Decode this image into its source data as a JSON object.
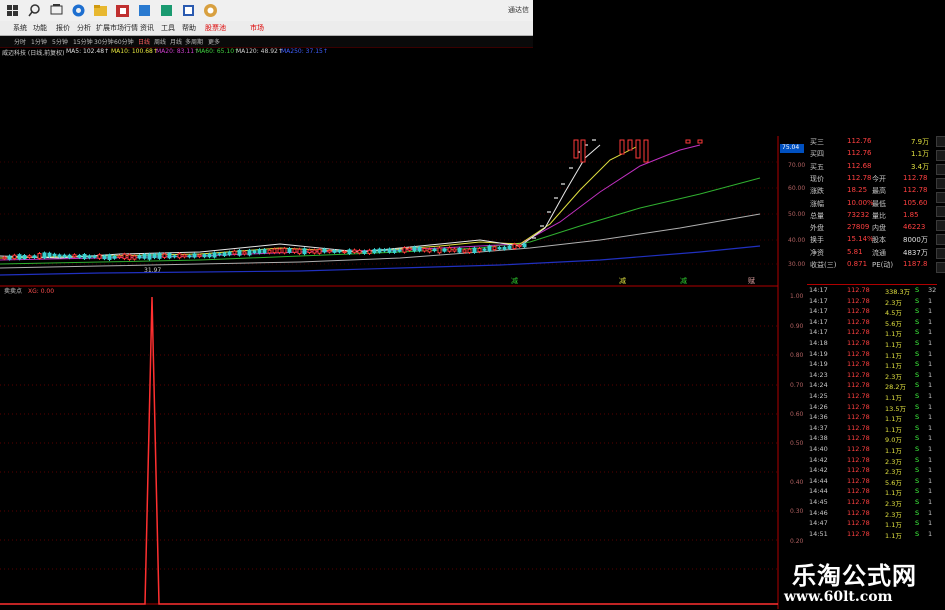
{
  "taskbar": {
    "icons": [
      "windows-icon",
      "search-icon",
      "task-view-icon",
      "edge-icon",
      "explorer-icon",
      "store-icon",
      "app-icon",
      "app-icon-2",
      "mail-icon",
      "trading-app-icon"
    ],
    "right_text": "通达信"
  },
  "menu": {
    "items": [
      "系统",
      "功能",
      "报价",
      "分析",
      "扩展市场行情",
      "资讯",
      "工具",
      "帮助"
    ],
    "highlight": "股票池",
    "market": "市场"
  },
  "timeframes": {
    "items": [
      "分时",
      "1分钟",
      "5分钟",
      "15分钟",
      "30分钟",
      "60分钟",
      "日线",
      "周线",
      "月线",
      "多周期",
      "更多"
    ]
  },
  "ma_bar": {
    "stock": "威迈科技 (日线,前复权)",
    "ma5": "MA5: 102.48↑",
    "ma10": "MA10: 100.68↑",
    "ma20": "MA20: 83.11↑",
    "ma60": "MA60: 65.10↑",
    "ma120": "MA120: 48.92↑",
    "ma250": "MA250: 37.15↑"
  },
  "price_axis": [
    "75.04",
    "70.00",
    "60.00",
    "50.00",
    "40.00",
    "30.00"
  ],
  "price_markers": [
    "31.97",
    "减",
    "减",
    "减",
    "赋"
  ],
  "indicator": {
    "title": "卖卖点",
    "value": "XG: 0.00",
    "axis": [
      "1.00",
      "0.90",
      "0.80",
      "0.70",
      "0.60",
      "0.50",
      "0.40",
      "0.30",
      "0.20",
      "0.10"
    ]
  },
  "quotes": [
    {
      "label": "买三",
      "price": "112.76",
      "vol": "7.9万"
    },
    {
      "label": "买四",
      "price": "112.76",
      "vol": "1.1万"
    },
    {
      "label": "买五",
      "price": "112.68",
      "vol": "3.4万"
    },
    {
      "label": "现价",
      "price": "112.78",
      "label2": "今开",
      "val2": "112.78"
    },
    {
      "label": "涨跌",
      "price": "18.25",
      "label2": "最高",
      "val2": "112.78"
    },
    {
      "label": "涨幅",
      "price": "10.00%",
      "label2": "最低",
      "val2": "105.60"
    },
    {
      "label": "总量",
      "price": "73232",
      "label2": "量比",
      "val2": "1.85"
    },
    {
      "label": "外盘",
      "price": "27809",
      "label2": "内盘",
      "val2": "46223"
    },
    {
      "label": "换手",
      "price": "15.14%",
      "label2": "股本",
      "val2": "8000万"
    },
    {
      "label": "净资",
      "price": "5.81",
      "label2": "流通",
      "val2": "4837万"
    },
    {
      "label": "收益(三)",
      "price": "0.871",
      "label2": "PE(动)",
      "val2": "1187.8"
    }
  ],
  "ticks": [
    {
      "t": "14:17",
      "p": "112.78",
      "v": "338.3万",
      "d": "S",
      "n": "32"
    },
    {
      "t": "14:17",
      "p": "112.78",
      "v": "2.3万",
      "d": "S",
      "n": "1"
    },
    {
      "t": "14:17",
      "p": "112.78",
      "v": "4.5万",
      "d": "S",
      "n": "1"
    },
    {
      "t": "14:17",
      "p": "112.78",
      "v": "5.6万",
      "d": "S",
      "n": "1"
    },
    {
      "t": "14:17",
      "p": "112.78",
      "v": "1.1万",
      "d": "S",
      "n": "1"
    },
    {
      "t": "14:18",
      "p": "112.78",
      "v": "1.1万",
      "d": "S",
      "n": "1"
    },
    {
      "t": "14:19",
      "p": "112.78",
      "v": "1.1万",
      "d": "S",
      "n": "1"
    },
    {
      "t": "14:19",
      "p": "112.78",
      "v": "1.1万",
      "d": "S",
      "n": "1"
    },
    {
      "t": "14:23",
      "p": "112.78",
      "v": "2.3万",
      "d": "S",
      "n": "1"
    },
    {
      "t": "14:24",
      "p": "112.78",
      "v": "28.2万",
      "d": "S",
      "n": "1"
    },
    {
      "t": "14:25",
      "p": "112.78",
      "v": "1.1万",
      "d": "S",
      "n": "1"
    },
    {
      "t": "14:26",
      "p": "112.78",
      "v": "13.5万",
      "d": "S",
      "n": "1"
    },
    {
      "t": "14:36",
      "p": "112.78",
      "v": "1.1万",
      "d": "S",
      "n": "1"
    },
    {
      "t": "14:37",
      "p": "112.78",
      "v": "1.1万",
      "d": "S",
      "n": "1"
    },
    {
      "t": "14:38",
      "p": "112.78",
      "v": "9.0万",
      "d": "S",
      "n": "1"
    },
    {
      "t": "14:40",
      "p": "112.78",
      "v": "1.1万",
      "d": "S",
      "n": "1"
    },
    {
      "t": "14:42",
      "p": "112.78",
      "v": "2.3万",
      "d": "S",
      "n": "1"
    },
    {
      "t": "14:42",
      "p": "112.78",
      "v": "2.3万",
      "d": "S",
      "n": "1"
    },
    {
      "t": "14:44",
      "p": "112.78",
      "v": "5.6万",
      "d": "S",
      "n": "1"
    },
    {
      "t": "14:44",
      "p": "112.78",
      "v": "1.1万",
      "d": "S",
      "n": "1"
    },
    {
      "t": "14:45",
      "p": "112.78",
      "v": "2.3万",
      "d": "S",
      "n": "1"
    },
    {
      "t": "14:46",
      "p": "112.78",
      "v": "2.3万",
      "d": "S",
      "n": "1"
    },
    {
      "t": "14:47",
      "p": "112.78",
      "v": "1.1万",
      "d": "S",
      "n": "1"
    },
    {
      "t": "14:51",
      "p": "112.78",
      "v": "1.1万",
      "d": "S",
      "n": "1"
    }
  ],
  "watermark": {
    "line1": "乐淘公式网",
    "line2": "www.60lt.com"
  },
  "colors": {
    "up": "#ff3a3a",
    "down": "#3ad0d0",
    "quote_price": "#ff4040",
    "sell_flag": "#40ff40",
    "grid": "#5a0000"
  }
}
